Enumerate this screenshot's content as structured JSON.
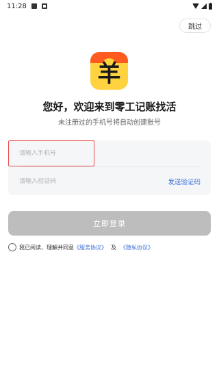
{
  "status_bar": {
    "time": "11:28"
  },
  "header": {
    "skip_label": "跳过"
  },
  "logo": {
    "glyph": "羊",
    "colors": {
      "background": "#ffd23f",
      "hat": "#ff5a1f"
    }
  },
  "welcome": {
    "title": "您好，欢迎来到零工记账找活",
    "subtitle": "未注册过的手机号将自动创建账号"
  },
  "form": {
    "phone_placeholder": "请输入手机号",
    "phone_value": "",
    "code_placeholder": "请输入验证码",
    "code_value": "",
    "send_code_label": "发送验证码"
  },
  "login": {
    "label": "立即登录"
  },
  "agreement": {
    "prefix": "我已阅读、理解并同意",
    "terms_label": "《服务协议》",
    "and_text": "及",
    "privacy_label": "《隐私协议》",
    "checked": false
  },
  "colors": {
    "accent": "#3c6fd8",
    "login_disabled": "#bdbdbd",
    "highlight_border": "#e64a4a"
  }
}
